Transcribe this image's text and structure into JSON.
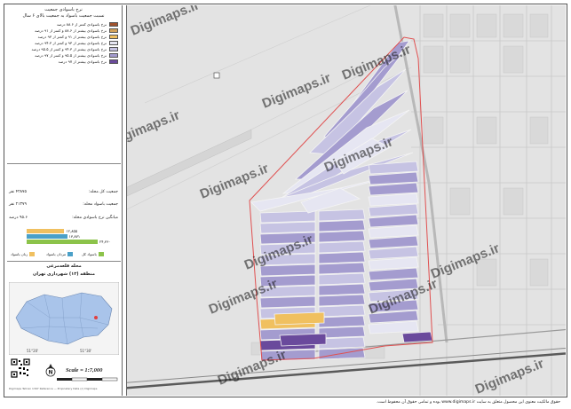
{
  "legend": {
    "title_line1": "نرخ باسوادی جمعیت",
    "title_line2": "نسبت جمعیت باسواد به جمعیت بالای ۶ سال",
    "classes": [
      {
        "label": "نرخ باسوادی کمتر از ۸۸.۶ درصد",
        "color": "#a0522d"
      },
      {
        "label": "نرخ باسوادی بیشتر از ۸۸.۶ و کمتر از ۹۱ درصد",
        "color": "#d2a15a"
      },
      {
        "label": "نرخ باسوادی بیشتر از ۹۱ و کمتر از ۹۳ درصد",
        "color": "#f0c060"
      },
      {
        "label": "نرخ باسوادی بیشتر از ۹۳ و کمتر از ۹۴.۳ درصد",
        "color": "#e6e6f2"
      },
      {
        "label": "نرخ باسوادی بیشتر از ۹۴.۳ و کمتر از ۹۵.۵ درصد",
        "color": "#c6c3e3"
      },
      {
        "label": "نرخ باسوادی بیشتر از ۹۵.۵ و کمتر از ۹۷ درصد",
        "color": "#a49ccf"
      },
      {
        "label": "نرخ باسوادی بیشتر از ۹۷ درصد",
        "color": "#6a4a9c"
      }
    ]
  },
  "stats": {
    "total_pop_label": "جمعیت کل محله:",
    "total_pop_value": "۴۲۸۷۵ نفر",
    "literate_pop_label": "جمعیت باسواد محله:",
    "literate_pop_value": "۲۱۳۷۹ نفر",
    "rate_label": "میانگین نرخ باسوادی محله:",
    "rate_value": "۹۵.۶ درصد"
  },
  "bars": [
    {
      "label": "۱۲,۸۵۵",
      "fraction": 0.53,
      "color": "#f0c060"
    },
    {
      "label": "۱۳,۸۷۱",
      "fraction": 0.57,
      "color": "#4aa0c8"
    },
    {
      "label": "۲۴,۳۶۰",
      "fraction": 1.0,
      "color": "#8cc34a"
    }
  ],
  "bar_keys": [
    {
      "label": "زنان باسواد",
      "color": "#f0c060"
    },
    {
      "label": "مردان باسواد",
      "color": "#4aa0c8"
    },
    {
      "label": "باسواد کل",
      "color": "#8cc34a"
    }
  ],
  "locator": {
    "title_line1": "محله قلعه‌مرغی",
    "title_line2": "منطقه (۱۳) شهرداری تهران"
  },
  "scale_text": "Scale = 1:7,000",
  "tiny_credit": "Digimaps Tehran 1397 Reference — Proprietary Data (c) Digimaps",
  "watermark": "Digimaps.ir",
  "footer": "حقوق مالکیت معنوی این محصول متعلق به سایت www.digimaps.ir بوده و تمامی حقوق آن محفوظ است.",
  "colors": {
    "boundary": "#e05050",
    "map_bg": "#e3e3e3",
    "road": "#5a5a5a"
  }
}
